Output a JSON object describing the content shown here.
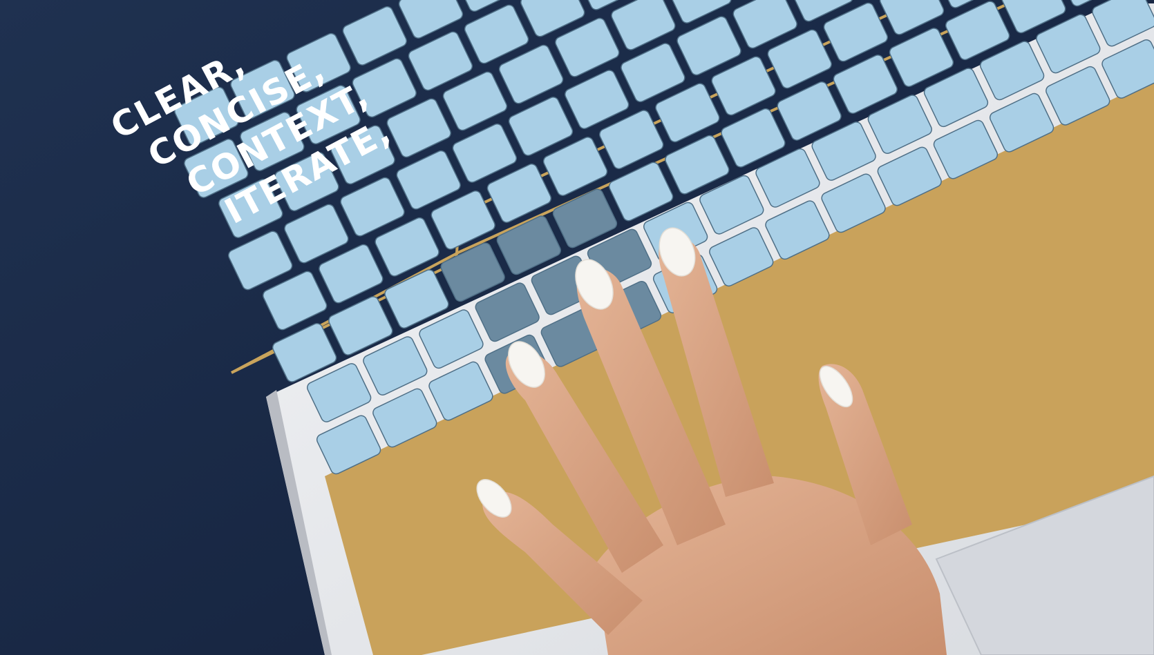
{
  "scene": {
    "description_words": [
      "CLEAR,",
      "CONCISE,",
      "CONTEXT,",
      "ITERATE,"
    ],
    "colors": {
      "background": "#1b2a44",
      "gold": "#c9a45c",
      "laptop_body": "#e6e8ec",
      "key": "#a9cfe6",
      "key_dark": "#6b8aa0",
      "skin": "#d9a585",
      "nail": "#f6f4f0"
    }
  }
}
